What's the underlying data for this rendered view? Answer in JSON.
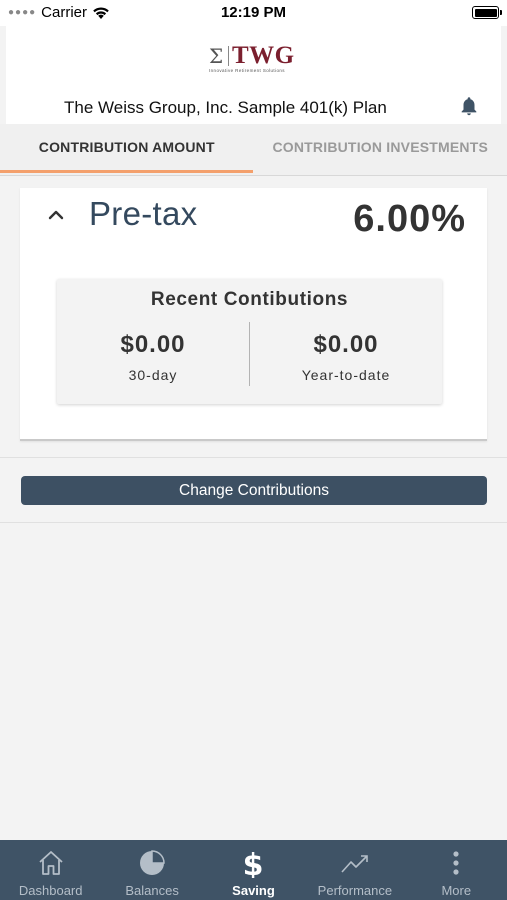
{
  "status_bar": {
    "carrier": "Carrier",
    "time": "12:19 PM"
  },
  "header": {
    "logo_text": "TWG",
    "logo_tagline": "Innovative Retirement Solutions",
    "plan_title": "The Weiss Group, Inc. Sample 401(k) Plan",
    "bell_icon": "bell-icon"
  },
  "tabs": [
    {
      "label": "CONTRIBUTION AMOUNT",
      "active": true
    },
    {
      "label": "CONTRIBUTION INVESTMENTS",
      "active": false
    }
  ],
  "card": {
    "title": "Pre-tax",
    "percent": "6.00%",
    "recent": {
      "title": "Recent Contibutions",
      "items": [
        {
          "value": "$0.00",
          "label": "30-day"
        },
        {
          "value": "$0.00",
          "label": "Year-to-date"
        }
      ]
    }
  },
  "change_button": "Change Contributions",
  "bottom_nav": [
    {
      "label": "Dashboard",
      "icon": "home-icon",
      "active": false
    },
    {
      "label": "Balances",
      "icon": "pie-chart-icon",
      "active": false
    },
    {
      "label": "Saving",
      "icon": "dollar-icon",
      "active": true
    },
    {
      "label": "Performance",
      "icon": "trend-line-icon",
      "active": false
    },
    {
      "label": "More",
      "icon": "more-vertical-icon",
      "active": false
    }
  ],
  "colors": {
    "accent": "#f4a06c",
    "nav_bg": "#3f5366",
    "button_bg": "#3d5063",
    "brand": "#7b1f2e"
  }
}
